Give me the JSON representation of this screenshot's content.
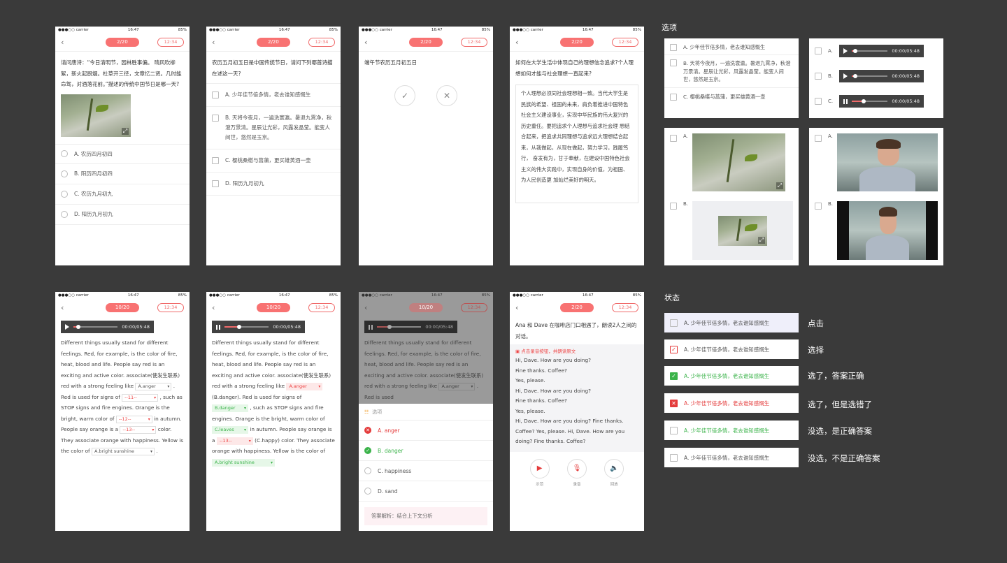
{
  "status": {
    "carrier": "●●●○○ carrier",
    "time": "16:47",
    "battery": "85%"
  },
  "p1": {
    "pill": "2/20",
    "timer": "12:34",
    "question": "请问唐诗：“今日清明节，园林胜事偏。 晴风吹柳絮，新火起厨烟。杜草开三径，文章忆二贤。几时能命驾，对酒落花前。”描述的传统中国节日是哪一天?",
    "options": [
      "A. 农历四月初四",
      "B. 阳历四月初四",
      "C. 农历九月初九",
      "D. 阳历九月初九"
    ]
  },
  "p2": {
    "pill": "2/20",
    "timer": "12:34",
    "question": "农历五月初五日是中国传统节日，请问下列哪首诗描在述这一天?",
    "options": [
      "A. 少年佳节倍多情，老去谁知感慨生",
      "B. 天将今夜月，一遍洗寰瀛。暑退九霄净，秋澄万景清。星辰让光彩，风露发晶莹。能变人间世，悠然是玉京。",
      "C. 樱桃桑椹与菖蒲，更买雄黄酒一壶",
      "D. 阳历九月初九"
    ]
  },
  "p3": {
    "pill": "2/20",
    "timer": "12:34",
    "question": "端午节农历五月初五日"
  },
  "p4": {
    "pill": "2/20",
    "timer": "12:34",
    "question": "如何在大学生活中体现自己的理想信念追求?个人理想如何才能与社会理想一直起来?",
    "answer": "个人理想必须同社会理想相一致。当代大学生是民族的希望、祖国的未来，肩负着推进中国特色社会主义建设事业，实现中华民族的伟大复兴的历史重任。要把追求个人理想与追求社会理 想结合起来，把追求共同理想与追求远大理想结合起来，从我做起，从现在做起，努力学习，践履笃行， 奋发有为，甘于奉献，在建设中国特色社会主义的伟大实践中，实现自身的价值，为祖国、为人民创造更 加灿烂美好的明天。"
  },
  "p5": {
    "pill": "10/20",
    "timer": "12:34",
    "audio_time": "00:00/05:48",
    "passage_a": "Different things usually stand for different feelings. Red, for example, is the color of fire, heat, blood and life. People say red is an exciting and active color. associate(使发生联系) red with a strong feeling like",
    "dd1": "A.anger",
    "passage_b": ". Red is used for signs of",
    "dd2": "--11--",
    "passage_c": ", such as STOP signs and fire engines. Orange is the bright, warm color of",
    "dd3": "--12--",
    "passage_d": "in autumn. People say orange is a",
    "dd4": "--13--",
    "passage_e": "color. They associate orange with happiness. Yellow is the color of",
    "dd5": "A.bright sunshine",
    "passage_f": "."
  },
  "p6": {
    "pill": "10/20",
    "timer": "12:34",
    "audio_time": "00:00/05:48",
    "passage_a": "Different things usually stand for different feelings. Red, for example, is the color of fire, heat, blood and life. People say red is an exciting and active color. associate(使发生联系) red with a strong feeling like",
    "dd1": "A.anger",
    "ans1": "(B.danger).",
    "passage_b": "Red is used for signs of",
    "dd2": "B.danger",
    "passage_c": ", such as STOP signs and fire engines. Orange is the bright, warm color of",
    "dd3": "C.leaves",
    "passage_d": "in autumn. People say orange is a",
    "dd4": "--13--",
    "ans4": "(C.happy)",
    "passage_e": "color. They associate orange with happiness. Yellow is the color of",
    "dd5": "A.bright sunshine"
  },
  "p7": {
    "pill": "10/20",
    "timer": "12:34",
    "audio_time": "00:00/05:48",
    "passage": "Different things usually stand for different feelings. Red, for example, is the color of fire, heat, blood and life. People say red is an exciting and active color. associate(使发生联系) red with a strong feeling like",
    "dd1": "A.anger",
    "tail": ". Red is used",
    "sheet_title": "选项",
    "options": [
      "A. anger",
      "B. danger",
      "C. happiness",
      "D. sand"
    ],
    "analysis": "答案解析：结合上下文分析"
  },
  "p8": {
    "pill": "2/20",
    "timer": "12:34",
    "intro": "Ana 和 Dave 在咖啡店门口相遇了，朗读2人之间的对话。",
    "hint": "点击录音按钮，并朗读原文",
    "dialog": "Hi, Dave. How are you doing?\nFine thanks. Coffee?\nYes, please.\nHi, Dave. How are you doing?\nFine thanks. Coffee?\nYes, please.\nHi, Dave. How are you doing? Fine thanks. Coffee? Yes, please. Hi, Dave. How are you doing? Fine thanks. Coffee?",
    "btn1": "示范",
    "btn2": "录音",
    "btn3": "回放"
  },
  "options_section": {
    "title": "选项",
    "text_options": [
      "A. 少年佳节倍多情，老去谁知感慨生",
      "B. 天将今夜月，一遍洗寰瀛。暑退九霄净，秋澄万景清。星辰让光彩，风露发晶莹。能变人间世，悠然是玉京。",
      "C. 樱桃桑椹与菖蒲，更买雄黄酒一壶"
    ],
    "audio_labels": [
      "A.",
      "B.",
      "C."
    ],
    "audio_time": "00:00/05:48",
    "img_labels": [
      "A.",
      "B."
    ]
  },
  "states": {
    "title": "状态",
    "opt": "A. 少年佳节倍多情，老去谁知感慨生",
    "labels": [
      "点击",
      "选择",
      "选了，答案正确",
      "选了，但是选错了",
      "没选，是正确答案",
      "没选，不是正确答案"
    ]
  },
  "colors": {
    "accent": "#f87272",
    "correct": "#3bb34a",
    "wrong": "#e43b3b"
  }
}
